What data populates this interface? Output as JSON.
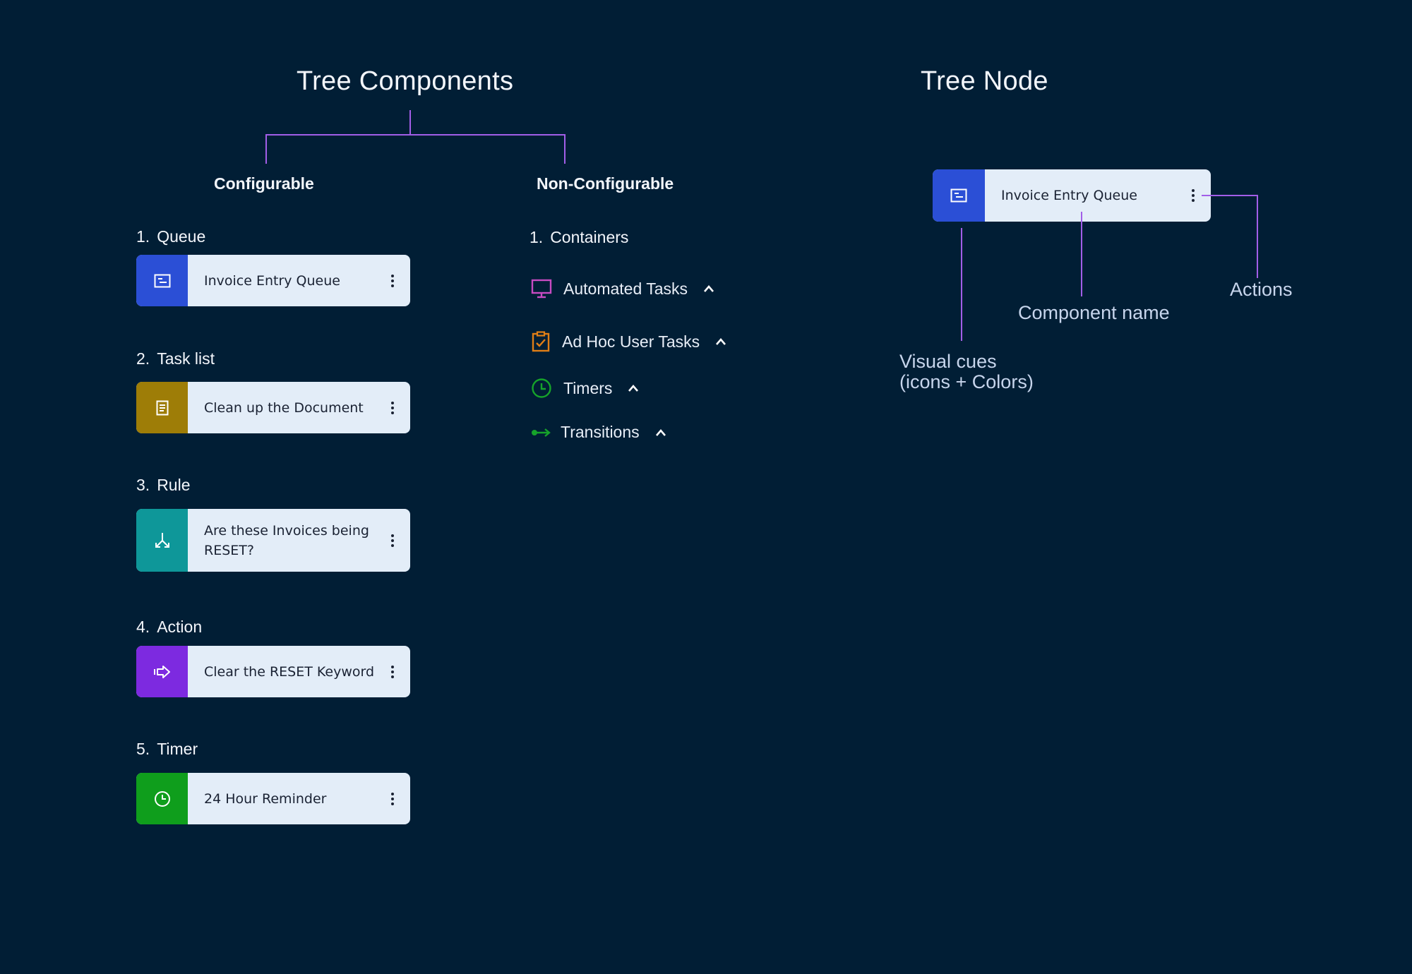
{
  "left_title": "Tree Components",
  "right_title": "Tree Node",
  "configurable": {
    "heading": "Configurable",
    "items": [
      {
        "number": "1.",
        "label": "Queue",
        "node_name": "Invoice Entry Queue",
        "color": "#2b4fd6",
        "icon": "queue-icon"
      },
      {
        "number": "2.",
        "label": "Task list",
        "node_name": "Clean up the Document",
        "color": "#9e7d07",
        "icon": "document-icon"
      },
      {
        "number": "3.",
        "label": "Rule",
        "node_name": "Are these Invoices being RESET?",
        "color": "#0e9799",
        "icon": "split-arrow-icon"
      },
      {
        "number": "4.",
        "label": "Action",
        "node_name": "Clear the RESET Keyword",
        "color": "#7d2ae0",
        "icon": "action-arrow-icon"
      },
      {
        "number": "5.",
        "label": "Timer",
        "node_name": "24 Hour Reminder",
        "color": "#0f9e1c",
        "icon": "clock-icon"
      }
    ]
  },
  "non_configurable": {
    "heading": "Non-Configurable",
    "section_number": "1.",
    "section_label": "Containers",
    "containers": [
      {
        "label": "Automated Tasks",
        "icon": "monitor-icon",
        "color": "#c84bc2"
      },
      {
        "label": "Ad Hoc User Tasks",
        "icon": "clipboard-check-icon",
        "color": "#e07e16"
      },
      {
        "label": "Timers",
        "icon": "clock-icon",
        "color": "#16a32a"
      },
      {
        "label": "Transitions",
        "icon": "transition-arrow-icon",
        "color": "#16a32a"
      }
    ]
  },
  "tree_node_example": {
    "node_name": "Invoice Entry Queue",
    "color": "#2b4fd6",
    "annotations": {
      "actions": "Actions",
      "component_name": "Component name",
      "visual_cues_line1": "Visual cues",
      "visual_cues_line2": "(icons + Colors)"
    }
  },
  "colors": {
    "background": "#011e35",
    "connector": "#a25ee8",
    "node_background": "#e3edf8"
  }
}
